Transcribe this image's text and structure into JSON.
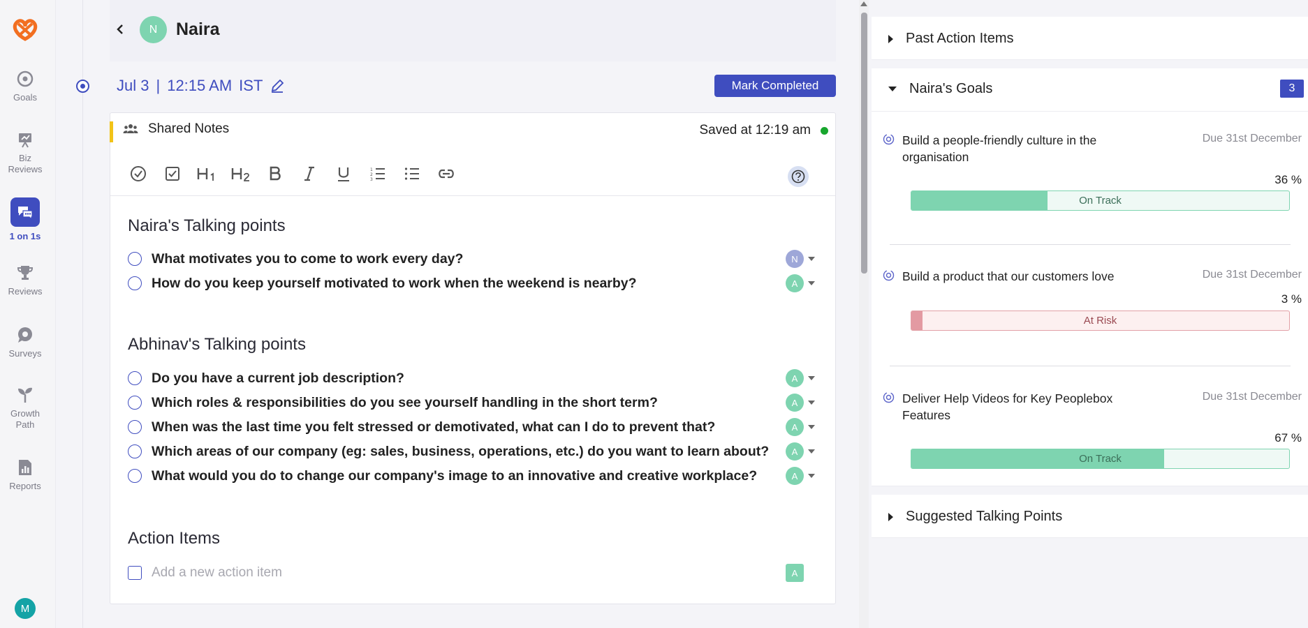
{
  "nav": {
    "items": [
      {
        "label": "Goals",
        "icon": "target-icon"
      },
      {
        "label": "Biz\nReviews",
        "icon": "presentation-icon"
      },
      {
        "label": "1 on 1s",
        "icon": "chat-bubbles-icon",
        "active": true
      },
      {
        "label": "Reviews",
        "icon": "trophy-icon"
      },
      {
        "label": "Surveys",
        "icon": "speech-bubble-icon"
      },
      {
        "label": "Growth\nPath",
        "icon": "sprout-icon"
      },
      {
        "label": "Reports",
        "icon": "report-chart-icon"
      }
    ],
    "user_initial": "M"
  },
  "header": {
    "avatar_initial": "N",
    "name": "Naira"
  },
  "meeting": {
    "date": "Jul 3",
    "separator": "|",
    "time": "12:15 AM",
    "timezone": "IST",
    "mark_completed_label": "Mark Completed"
  },
  "notes": {
    "title": "Shared Notes",
    "saved_status": "Saved at 12:19 am"
  },
  "sections": {
    "naira_title": "Naira's Talking points",
    "naira_points": [
      {
        "text": "What motivates you to come to work every day?",
        "owner": "N"
      },
      {
        "text": "How do you keep yourself motivated to work when the weekend is nearby?",
        "owner": "A"
      }
    ],
    "abhinav_title": "Abhinav's Talking points",
    "abhinav_points": [
      {
        "text": "Do you have a current job description?",
        "owner": "A"
      },
      {
        "text": "Which roles & responsibilities do you see yourself handling in the short term?",
        "owner": "A"
      },
      {
        "text": "When was the last time you felt stressed or demotivated, what can I do to prevent that?",
        "owner": "A"
      },
      {
        "text": "Which areas of our company (eg: sales, business, operations, etc.) do you want to learn about?",
        "owner": "A"
      },
      {
        "text": "What would you do to change our company's image to an innovative and creative workplace?",
        "owner": "A"
      }
    ],
    "action_title": "Action Items",
    "action_placeholder": "Add a new action item",
    "action_owner": "A"
  },
  "right_panel": {
    "past_action_items": "Past Action Items",
    "goals_title": "Naira's Goals",
    "goals_count": "3",
    "goals": [
      {
        "title": "Build a people-friendly culture in the organisation",
        "due": "Due 31st December",
        "percent_label": "36 %",
        "progress": 36,
        "status": "On Track"
      },
      {
        "title": "Build a product that our customers love",
        "due": "Due 31st December",
        "percent_label": "3 %",
        "progress": 3,
        "status": "At Risk"
      },
      {
        "title": "Deliver Help Videos for Key Peoplebox Features",
        "due": "Due 31st December",
        "percent_label": "67 %",
        "progress": 67,
        "status": "On Track"
      }
    ],
    "suggested_title": "Suggested Talking Points"
  },
  "colors": {
    "accent": "#3f4dbf",
    "on_track": "#7ed4b0",
    "at_risk": "#e39aa2",
    "saved_dot": "#17a62d",
    "notes_accent": "#f2c318"
  }
}
